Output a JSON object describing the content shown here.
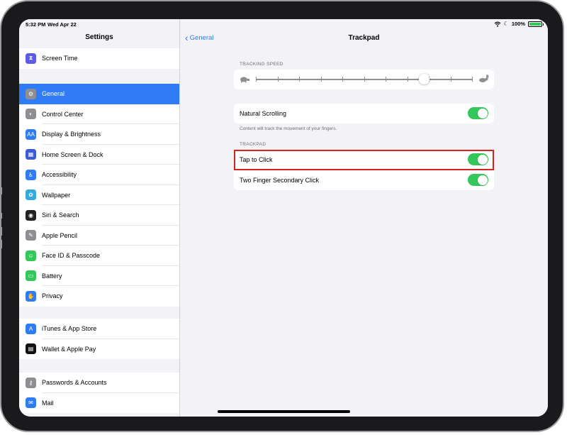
{
  "status_bar": {
    "time": "5:32 PM",
    "date": "Wed Apr 22",
    "battery": "100%",
    "battery_level": 1.0
  },
  "sidebar": {
    "title": "Settings",
    "groups": [
      [
        {
          "label": "Screen Time",
          "icon": "hourglass-icon",
          "color": "#5e5ce6"
        }
      ],
      [
        {
          "label": "General",
          "icon": "gear-icon",
          "color": "#8e8e93",
          "selected": true
        },
        {
          "label": "Control Center",
          "icon": "toggles-icon",
          "color": "#8e8e93"
        },
        {
          "label": "Display & Brightness",
          "icon": "text-size-icon",
          "color": "#2f7cf6"
        },
        {
          "label": "Home Screen & Dock",
          "icon": "app-grid-icon",
          "color": "#3b5bdb"
        },
        {
          "label": "Accessibility",
          "icon": "accessibility-icon",
          "color": "#2f7cf6"
        },
        {
          "label": "Wallpaper",
          "icon": "flower-icon",
          "color": "#35aadc"
        },
        {
          "label": "Siri & Search",
          "icon": "siri-icon",
          "color": "#222222"
        },
        {
          "label": "Apple Pencil",
          "icon": "pencil-icon",
          "color": "#8e8e93"
        },
        {
          "label": "Face ID & Passcode",
          "icon": "face-id-icon",
          "color": "#34c759"
        },
        {
          "label": "Battery",
          "icon": "battery-icon",
          "color": "#34c759"
        },
        {
          "label": "Privacy",
          "icon": "hand-icon",
          "color": "#2f7cf6"
        }
      ],
      [
        {
          "label": "iTunes & App Store",
          "icon": "app-store-icon",
          "color": "#2f7cf6"
        },
        {
          "label": "Wallet & Apple Pay",
          "icon": "wallet-icon",
          "color": "#111111"
        }
      ],
      [
        {
          "label": "Passwords & Accounts",
          "icon": "key-icon",
          "color": "#8e8e93"
        },
        {
          "label": "Mail",
          "icon": "mail-icon",
          "color": "#2f7cf6"
        }
      ]
    ]
  },
  "detail": {
    "back_label": "General",
    "title": "Trackpad",
    "tracking_speed": {
      "section_label": "TRACKING SPEED",
      "level": 0.78,
      "tick_count": 11,
      "slow_icon": "turtle-icon",
      "fast_icon": "rabbit-icon"
    },
    "natural_scrolling": {
      "label": "Natural Scrolling",
      "on": true
    },
    "natural_scrolling_footer": "Content will track the movement of your fingers.",
    "trackpad_section_label": "TRACKPAD",
    "tap_to_click": {
      "label": "Tap to Click",
      "on": true
    },
    "two_finger": {
      "label": "Two Finger Secondary Click",
      "on": true
    }
  },
  "colors": {
    "accent": "#2f7cf6",
    "toggle_on": "#34c759",
    "highlight": "#d5231d"
  }
}
